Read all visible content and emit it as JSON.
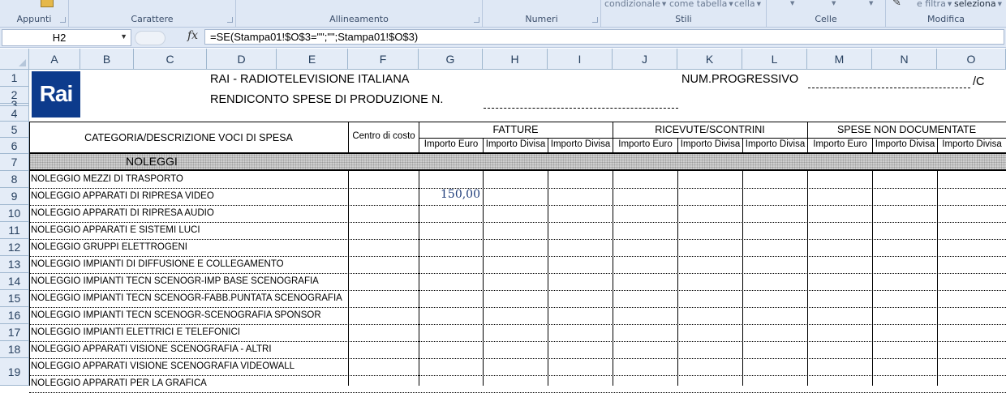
{
  "ribbon": {
    "groups": [
      {
        "label": "Appunti"
      },
      {
        "label": "Carattere"
      },
      {
        "label": "Allineamento"
      },
      {
        "label": "Numeri"
      },
      {
        "label": "Stili"
      },
      {
        "label": "Celle"
      },
      {
        "label": "Modifica"
      }
    ],
    "stili_items": [
      "condizionale",
      "come tabella",
      "cella"
    ],
    "modifica_items": [
      "e filtra",
      "seleziona"
    ]
  },
  "formula_bar": {
    "name_box": "H2",
    "fx_label": "fx",
    "formula": "=SE(Stampa01!$O$3=\"\";\"\";Stampa01!$O$3)"
  },
  "columns": [
    "A",
    "B",
    "C",
    "D",
    "E",
    "F",
    "G",
    "H",
    "I",
    "J",
    "K",
    "L",
    "M",
    "N",
    "O"
  ],
  "rows": [
    "1",
    "2",
    "3",
    "4",
    "5",
    "6",
    "7",
    "8",
    "9",
    "10",
    "11",
    "12",
    "13",
    "14",
    "15",
    "16",
    "17",
    "18",
    "19"
  ],
  "sheet": {
    "logo_text": "Rai",
    "title1": "RAI - RADIOTELEVISIONE ITALIANA",
    "title2": "RENDICONTO SPESE DI PRODUZIONE N.",
    "num_label": "NUM.PROGRESSIVO",
    "num_suffix": "/C",
    "cat_header": "CATEGORIA/DESCRIZIONE VOCI DI SPESA",
    "centro_header": "Centro di costo",
    "fatture": "FATTURE",
    "ricevute": "RICEVUTE/SCONTRINI",
    "spese": "SPESE NON DOCUMENTATE",
    "sub_headers": [
      "Importo Euro",
      "Importo Divisa",
      "Importo Divisa",
      "Importo Euro",
      "Importo Divisa",
      "Importo Divisa",
      "Importo Euro",
      "Importo Divisa",
      "Importo Divisa"
    ],
    "section": "NOLEGGI",
    "items": [
      "NOLEGGIO MEZZI DI TRASPORTO",
      "NOLEGGIO APPARATI DI RIPRESA VIDEO",
      "NOLEGGIO APPARATI DI RIPRESA AUDIO",
      "NOLEGGIO APPARATI E SISTEMI LUCI",
      "NOLEGGIO GRUPPI ELETTROGENI",
      "NOLEGGIO IMPIANTI DI DIFFUSIONE E COLLEGAMENTO",
      "NOLEGGIO IMPIANTI TECN SCENOGR-IMP BASE SCENOGRAFIA",
      "NOLEGGIO IMPIANTI TECN SCENOGR-FABB.PUNTATA SCENOGRAFIA",
      "NOLEGGIO IMPIANTI TECN SCENOGR-SCENOGRAFIA SPONSOR",
      "NOLEGGIO IMPIANTI ELETTRICI E TELEFONICI",
      "NOLEGGIO APPARATI VISIONE SCENOGRAFIA - ALTRI",
      "NOLEGGIO APPARATI VISIONE SCENOGRAFIA VIDEOWALL",
      "NOLEGGIO APPARATI PER LA GRAFICA"
    ],
    "value_g8": "150,00",
    "colors": {
      "logo_bg": "#0d3b8c",
      "value_text": "#1f3d7a",
      "header_bg": "#e4ecf7"
    }
  }
}
